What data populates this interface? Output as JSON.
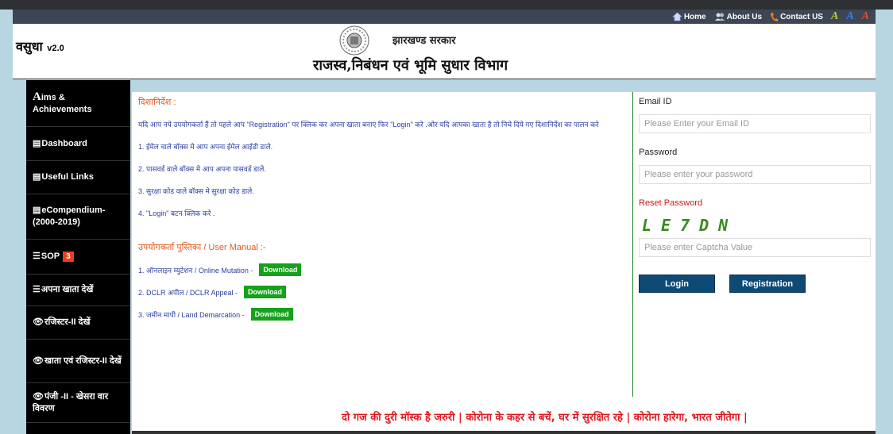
{
  "topnav": {
    "home": "Home",
    "about": "About Us",
    "contact": "Contact US",
    "font_a": "A"
  },
  "header": {
    "brand": "वसुधा",
    "version": "v2.0",
    "govt": "झारखण्ड सरकार",
    "dept": "राजस्व,निबंधन एवं भूमि सुधार  विभाग"
  },
  "sidebar": {
    "items": [
      {
        "lead": "A",
        "label": "ims & Achievements"
      },
      {
        "label": "Dashboard"
      },
      {
        "label": "Useful Links"
      },
      {
        "label": "eCompendium-(2000-2019)"
      },
      {
        "label": "SOP",
        "badge": "3"
      },
      {
        "label": "अपना खाता देखें"
      },
      {
        "label": "रजिस्टर-II देखें"
      },
      {
        "label": "खाता एवं रजिस्टर-II देखें"
      },
      {
        "label": "पंजी -II - खेसरा वार विवरण"
      }
    ]
  },
  "instructions": {
    "heading": "दिशानिर्देश :",
    "intro": "यदि आप नये उपयोगकर्ता हैं तो पहले आप \"Registration\" पर क्लिक कर अपना खाता बनाएं फिर \"Login\" करे .ओर यदि आपका खाता है तो निचे दिये गए दिशानिर्देश का पालन करे",
    "steps": [
      "1. ईमेल वाले बॉक्स मे आप अपना ईमेल आईडी डाले.",
      "2. पासवर्ड वाले बॉक्स मे आप अपना पासवर्ड डाले.",
      "3. सुरक्षा कोड वाले बॉक्स मे सुरक्षा कोड डाले.",
      "4. \"Login\" बटन क्लिक करे ."
    ],
    "manual_heading": "उपयोगकर्ता पुस्तिका / User Manual :-",
    "manuals": [
      {
        "label": "1. ऑनलाइन म्युटेशन / Online Mutation -",
        "button": "Download"
      },
      {
        "label": "2. DCLR अपील / DCLR Appeal -",
        "button": "Download"
      },
      {
        "label": "3. जमीन मापी / Land Demarcation -",
        "button": "Download"
      }
    ]
  },
  "login": {
    "email_label": "Email ID",
    "email_placeholder": "Please Enter your Email ID",
    "password_label": "Password",
    "password_placeholder": "Please enter your password",
    "reset": "Reset Password",
    "captcha": "LE7DN",
    "captcha_placeholder": "Please enter Captcha Value",
    "login_button": "Login",
    "register_button": "Registration"
  },
  "ticker": "दो गज की दुरी मॉस्क है जरुरी | कोरोना के कहर से बचें, घर में सुरक्षित रहे | कोरोना हारेगा, भारत जीतेगा |",
  "colors": {
    "sidebar_bg": "#000000",
    "accent_blue": "#0e4a76",
    "download_green": "#15a21a",
    "ticker_red": "#e0191f"
  }
}
